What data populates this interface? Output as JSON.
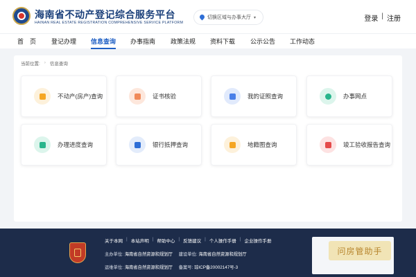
{
  "header": {
    "title": "海南省不动产登记综合服务平台",
    "subtitle": "HAINAN REAL ESTATE REGISTRATION COMPREHENSIVE SERVICE PLATFORM",
    "region_label": "切换区域与办事大厅",
    "login": "登录",
    "separator": "|",
    "register": "注册"
  },
  "nav": {
    "items": [
      {
        "label": "首　页"
      },
      {
        "label": "登记办理"
      },
      {
        "label": "信息查询"
      },
      {
        "label": "办事指南"
      },
      {
        "label": "政策法规"
      },
      {
        "label": "资料下载"
      },
      {
        "label": "公示公告"
      },
      {
        "label": "工作动态"
      }
    ],
    "active_index": 2
  },
  "breadcrumb": {
    "label": "当前位置:",
    "current": "信息查询"
  },
  "tiles": [
    {
      "label": "不动产(房产)查询",
      "icon": "house-document-icon",
      "color": "#f5a623",
      "bg": "#fdf1db"
    },
    {
      "label": "证书核验",
      "icon": "certificate-check-icon",
      "color": "#f08a5a",
      "bg": "#fde7dc"
    },
    {
      "label": "我的证照查询",
      "icon": "id-card-icon",
      "color": "#4a7fe8",
      "bg": "#e1eafc"
    },
    {
      "label": "办事网点",
      "icon": "location-icon",
      "color": "#29b58c",
      "bg": "#dcf5ec"
    },
    {
      "label": "办理进度查询",
      "icon": "progress-search-icon",
      "color": "#29b58c",
      "bg": "#dcf5ec"
    },
    {
      "label": "银行抵押查询",
      "icon": "bank-house-icon",
      "color": "#2e6ed6",
      "bg": "#e3ecfb"
    },
    {
      "label": "地籍图查询",
      "icon": "map-icon",
      "color": "#f5a623",
      "bg": "#fdf1db"
    },
    {
      "label": "竣工验收报告查询",
      "icon": "flag-report-icon",
      "color": "#e54b4b",
      "bg": "#fde2e2"
    }
  ],
  "footer": {
    "links": [
      "关于本网",
      "本站声明",
      "帮助中心",
      "反馈建议",
      "个人操作手册",
      "企业操作手册"
    ],
    "link_separator": "|",
    "sponsor_label": "主办单位:",
    "sponsor": "海南省自然资源和规划厅",
    "builder_label": "建设单位:",
    "builder": "海南省自然资源和规划厅",
    "operator_label": "运维单位:",
    "operator": "海南省自然资源和规划厅",
    "icp_label": "备案号:",
    "icp": "琼ICP备20002147号-3"
  },
  "watermark": "问房管助手",
  "colors": {
    "primary": "#1f5fc4",
    "title": "#1a3f7a",
    "footer_bg": "#1d2c4a"
  }
}
